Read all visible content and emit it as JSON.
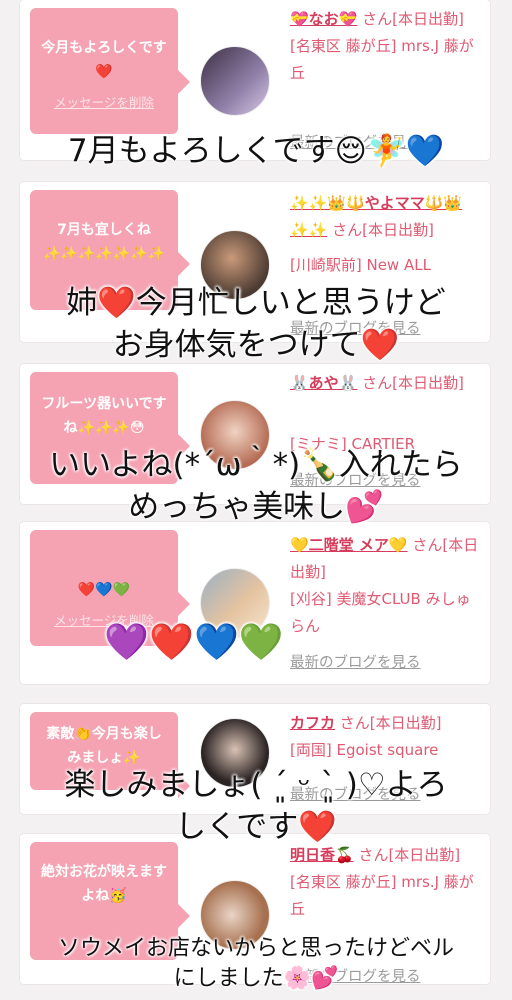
{
  "cards": [
    {
      "bubble": "今月もよろしくです❤️",
      "delete_label": "メッセージを削除",
      "name": "💝なお💝",
      "status": " さん[本日出勤]",
      "location": "[名東区 藤が丘] mrs.J 藤が丘",
      "blog_label": "最新のブログを見る",
      "avatar_colors": [
        "#3d2f44",
        "#8f7fa8"
      ]
    },
    {
      "bubble": "7月も宜しくね\n✨✨✨✨✨✨✨",
      "delete_label": "",
      "name": "✨✨👑🔱やよママ🔱👑✨✨",
      "status": " さん[本日出勤]",
      "location": "[川崎駅前] New ALL",
      "blog_label": "最新のブログを見る",
      "avatar_colors": [
        "#c99a7a",
        "#4b3a31"
      ]
    },
    {
      "bubble": "フルーツ器いいですね✨✨✨😳",
      "delete_label": "",
      "name": "🐰あや🐰",
      "status": " さん[本日出勤]",
      "location": "[ミナミ] CARTIER",
      "blog_label": "最新のブログを見る",
      "avatar_colors": [
        "#b46a52",
        "#f1d3c3"
      ]
    },
    {
      "bubble": "❤️💙💚",
      "delete_label": "メッセージを削除",
      "name": "💛二階堂 メア💛",
      "status": " さん[本日出勤]",
      "location": "[刈谷] 美魔女CLUB みしゅらん",
      "blog_label": "最新のブログを見る",
      "avatar_colors": [
        "#e4c3a0",
        "#9bb0c4"
      ]
    },
    {
      "bubble": "素敵👏今月も楽しみましょ✨",
      "delete_label": "",
      "name": "カフカ",
      "status": " さん[本日出勤]",
      "location": "[両国] Egoist square",
      "blog_label": "最新のブログを見る",
      "avatar_colors": [
        "#2a2323",
        "#d9c2b4"
      ]
    },
    {
      "bubble": "絶対お花が映えますよね🥳",
      "delete_label": "",
      "name": "明日香🍒",
      "status": " さん[本日出勤]",
      "location": "[名東区 藤が丘] mrs.J 藤が丘",
      "blog_label": "最新のブログを見る",
      "avatar_colors": [
        "#a7704f",
        "#e9d5c6"
      ]
    }
  ],
  "overlays": [
    "7月もよろしくです😌🧚💙",
    "姉❤️今月忙しいと思うけど\nお身体気をつけて❤️",
    "いいよね(*´ω｀*)🍾入れたら\nめっちゃ美味し💕",
    "💜❤️💙💚",
    "楽しみましょ( ´͈ ᵕ `͈ )♡よろ\nしくです❤️",
    "ソウメイお店ないからと思ったけどベル\nにしました🌸💕"
  ]
}
